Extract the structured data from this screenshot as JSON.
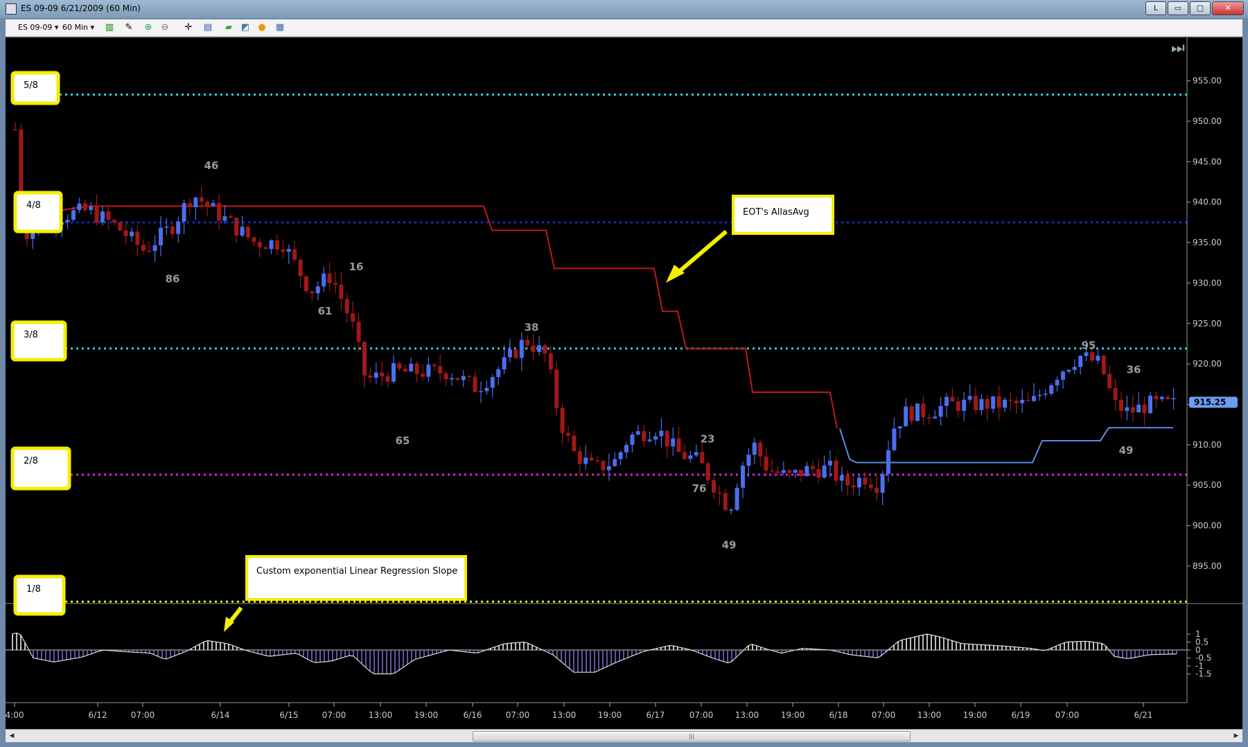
{
  "window": {
    "title": "ES 09-09  6/21/2009 (60 Min)",
    "controls": [
      "L",
      "▭",
      "□",
      "✕"
    ]
  },
  "toolbar": {
    "instrument": "ES 09-09",
    "interval": "60 Min"
  },
  "annotations": {
    "eot_label": "EOT's AllasAvg",
    "slope_label": "Custom exponential Linear Regression Slope",
    "levels": [
      {
        "label": "5/8",
        "price": 953.3,
        "color": "#26d4d4"
      },
      {
        "label": "4/8",
        "price": 937.5,
        "color": "#1a2bd0"
      },
      {
        "label": "3/8",
        "price": 921.9,
        "color": "#26d4d4"
      },
      {
        "label": "2/8",
        "price": 906.3,
        "color": "#d42ad4"
      },
      {
        "label": "1/8",
        "price": 890.6,
        "color": "#e8e020"
      }
    ]
  },
  "price_axis": {
    "labels": [
      "955.00",
      "950.00",
      "945.00",
      "940.00",
      "935.00",
      "930.00",
      "925.00",
      "920.00",
      "915.00",
      "910.00",
      "905.00",
      "900.00",
      "895.00"
    ],
    "last_price": "915.25"
  },
  "osc_axis": {
    "labels": [
      "1",
      "0.5",
      "0",
      "-0.5",
      "-1",
      "-1.5"
    ]
  },
  "time_axis": {
    "labels": [
      "4:00",
      "6/12",
      "07:00",
      "6/14",
      "6/15",
      "07:00",
      "13:00",
      "19:00",
      "6/16",
      "07:00",
      "13:00",
      "19:00",
      "6/17",
      "07:00",
      "13:00",
      "19:00",
      "6/18",
      "07:00",
      "13:00",
      "19:00",
      "6/19",
      "07:00",
      "6/21"
    ]
  },
  "bar_labels": [
    "46",
    "86",
    "16",
    "61",
    "65",
    "38",
    "23",
    "76",
    "49",
    "95",
    "36",
    "49"
  ],
  "colors": {
    "up_bar": "#4a6ef0",
    "down_bar": "#a01818",
    "avg_red": "#c01818",
    "avg_blue": "#5a8ee6",
    "osc_neg": "#7b72d8",
    "osc_pos": "#ffffff"
  }
}
